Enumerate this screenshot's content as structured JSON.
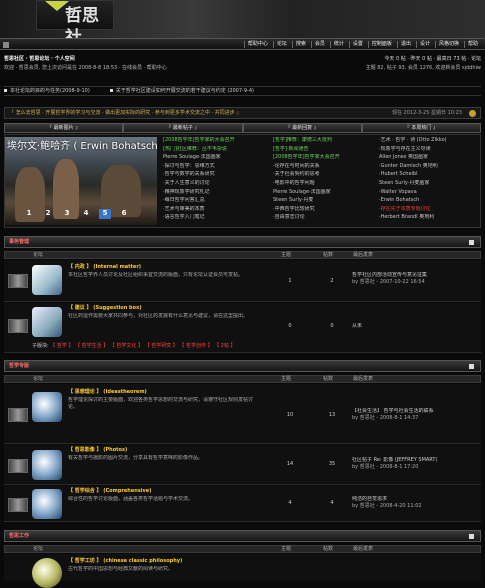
{
  "header": {
    "logo_text": "哲思社"
  },
  "nav": {
    "items": [
      "帮助中心",
      "论坛",
      "搜索",
      "会员",
      "统计",
      "设置",
      "控制面板",
      "退出",
      "设计",
      "风格切换",
      "帮助"
    ]
  },
  "user": {
    "welcome": "哲思社区 · 哲思论坛 · 个人空间",
    "status": "欢迎 · 哲思会员, 您上次访问是在 2008-8-8 18:53 · 在线会员 · 帮助中心",
    "online": "今天 0 帖 · 昨天 0 帖 · 最高日 73 帖 · 论坛",
    "stats": "主题 82, 帖子 93, 会员 1276, 欢迎新会员 sjddhiw"
  },
  "ticker": [
    "本社论坛的目的与任务(2008-9-10)",
    "关于哲学社区建设如何开展交流的若干建议与约定 (2007-9-4)"
  ],
  "notice": {
    "text": "『 怎么去哲思 · 开展哲学界的学习与交流 · 做出更加实际的研究 · 参与到更多学术交流之中 · 共同进步 』",
    "right": "现在 2012-3-25 星期日 10:23"
  },
  "tabs": [
    "『 最新图片 』",
    "『 最新帖子 』",
    "『 最新回复 』",
    "『 本周热门 』"
  ],
  "slider": {
    "title": "埃尔文·鲍哈齐 ( Erwin Bohatsch )",
    "pages": [
      "1",
      "2",
      "3",
      "4",
      "5",
      "6"
    ],
    "active": "5"
  },
  "col_posts": [
    "[2008哲学年]哲学家的大会召开",
    "[热门]社区推荐：吕不韦杂说",
    "Pierre Soulage·法国画家",
    "·探讨与哲学：思维方式",
    "·哲学与数学的关系研究",
    "·关于人生意义的讨论",
    "·精神现象学研究札记",
    "·每日哲学问答汇总",
    "·艺术与审美的本质",
    "·语言哲学入门笔记"
  ],
  "col_replies": [
    "[哲学]推荐：康德三大批判",
    "[哲学]·新闻通告",
    "[2008哲学年]哲学家大会召开",
    "·论存在与时间的关系",
    "·关于社会契约的思考",
    "·电影中的哲学问题",
    "Pierre Soulage·法国画家",
    "Steen Surly·丹麦",
    "·中西哲学比较研究",
    "·自由意志讨论"
  ],
  "col_hot": [
    "·艺术 · 哲学 · 诗 (Otto Zikko)",
    "·现象学与存在主义导读",
    "Allen Jones 英国画家",
    "·Gunter Damisch 奥地利",
    "·Hubert Scheibl",
    "Steen Surly·丹麦画家",
    "·Walter Vopava",
    "·Erwin Bohatsch",
    "·存在先于本质专题讨论",
    "·Herbert Brandl 奥地利"
  ],
  "sections": [
    {
      "title": "事务管理",
      "cols": [
        "论坛",
        "主题",
        "帖数",
        "最后发表"
      ]
    },
    {
      "title": "哲学专版",
      "cols": [
        "论坛",
        "主题",
        "帖数",
        "最后发表"
      ]
    },
    {
      "title": "哲思工作",
      "cols": [
        "论坛",
        "主题",
        "帖数",
        "最后发表"
      ]
    }
  ],
  "forums": [
    {
      "name": "【 内政 】 (Internal matter)",
      "desc": "本社区哲学界人员讨论及社区组织事宜交流的版面，只有论坛认证会员可发帖。",
      "topics": "1",
      "posts": "2",
      "last": "哲学社区内部活动宣传与意见征集",
      "last_by": "by 哲思社 - 2007-10-22 16:54"
    },
    {
      "name": "【 建议 】 (Suggestion box)",
      "desc": "社区的运作需要大家共同参与，对社区的发展有什么意见与建议，请在这里提出。",
      "topics": "0",
      "posts": "0",
      "last": "从未",
      "last_by": ""
    },
    {
      "name": "【 思想理论 】 (Ideastheorem)",
      "desc": "哲学理论探讨的主要版面，欢迎各类哲学思想的交流与研究，请遵守社区规则发帖讨论。",
      "topics": "10",
      "posts": "13",
      "last": "【社会生活】 哲学与社会生活的联系",
      "last_by": "by 哲思社 - 2008-8-1 14:37"
    },
    {
      "name": "【 哲思影像 】 (Photos)",
      "desc": "有关哲学与摄影的图片交流，分享具有哲学意味的影像作品。",
      "topics": "14",
      "posts": "35",
      "last": "社区帖子 Re: 影像 (JEFFREY SMART)",
      "last_by": "by 哲思社 - 2008-8-1 17:20"
    },
    {
      "name": "【 哲学综合 】 (Comprehensive)",
      "desc": "综合性的哲学讨论版面，涵盖各类哲学话题与学术交流。",
      "topics": "4",
      "posts": "4",
      "last": "纯洁的自觉追求",
      "last_by": "by 哲思社 - 2008-4-20 11:02"
    },
    {
      "name": "【 哲学工坊 】 (chinese classic philosophy)",
      "desc": "古代哲学的中国思想与经典文献的阅读与研究。",
      "topics": "",
      "posts": "",
      "last": "",
      "last_by": ""
    }
  ],
  "moderators": {
    "label": "子版块:",
    "items": [
      "【 哲学 】",
      "【 哲学生活 】",
      "【 哲学文化 】",
      "【 哲学研究 】",
      "【 哲学创作 】"
    ],
    "suffix": "【 2帖 】"
  }
}
